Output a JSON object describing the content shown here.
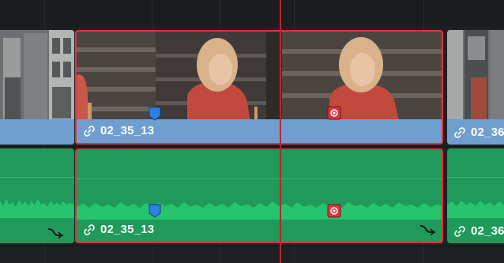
{
  "video_track": {
    "clips": [
      {
        "name": ""
      },
      {
        "name": "02_35_13"
      },
      {
        "name": "02_36"
      }
    ]
  },
  "audio_track": {
    "clips": [
      {
        "name": ""
      },
      {
        "name": "02_35_13"
      },
      {
        "name": "02_36"
      }
    ]
  },
  "colors": {
    "video_clip": "#6f9fcf",
    "audio_clip": "#1f9a5b",
    "selection": "#e0333a",
    "playhead": "#b8262d",
    "marker_blue": "#2f7fe0",
    "marker_red": "#e0333a"
  },
  "icons": [
    "link-icon",
    "marker-blue-icon",
    "marker-red-icon",
    "fade-handle-icon"
  ]
}
